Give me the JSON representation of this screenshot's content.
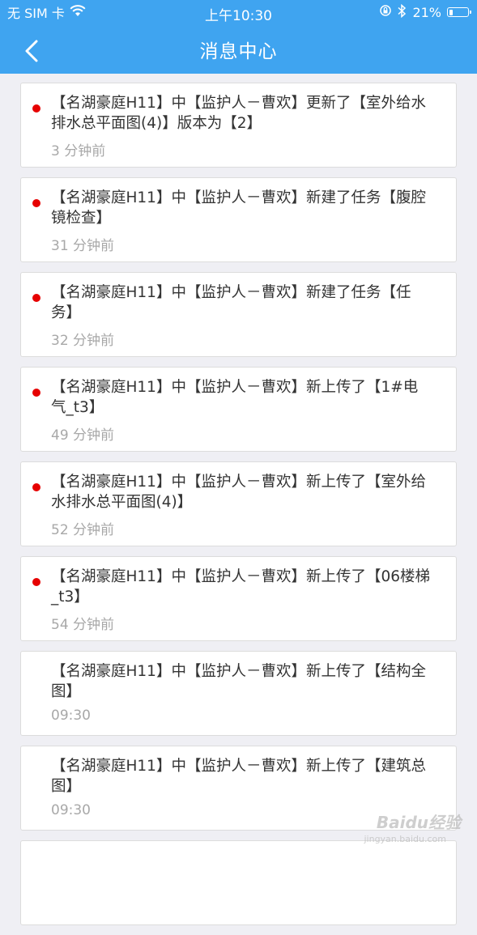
{
  "status_bar": {
    "carrier": "无 SIM 卡",
    "time": "上午10:30",
    "battery_text": "21%",
    "battery_level": 0.21
  },
  "header": {
    "title": "消息中心"
  },
  "messages": [
    {
      "text": "【名湖豪庭H11】中【监护人－曹欢】更新了【室外给水排水总平面图(4)】版本为【2】",
      "time": "3 分钟前",
      "unread": true
    },
    {
      "text": "【名湖豪庭H11】中【监护人－曹欢】新建了任务【腹腔镜检查】",
      "time": "31 分钟前",
      "unread": true
    },
    {
      "text": "【名湖豪庭H11】中【监护人－曹欢】新建了任务【任务】",
      "time": "32 分钟前",
      "unread": true
    },
    {
      "text": "【名湖豪庭H11】中【监护人－曹欢】新上传了【1#电气_t3】",
      "time": "49 分钟前",
      "unread": true
    },
    {
      "text": "【名湖豪庭H11】中【监护人－曹欢】新上传了【室外给水排水总平面图(4)】",
      "time": "52 分钟前",
      "unread": true
    },
    {
      "text": "【名湖豪庭H11】中【监护人－曹欢】新上传了【06楼梯_t3】",
      "time": "54 分钟前",
      "unread": true
    },
    {
      "text": "【名湖豪庭H11】中【监护人－曹欢】新上传了【结构全图】",
      "time": "09:30",
      "unread": false
    },
    {
      "text": "【名湖豪庭H11】中【监护人－曹欢】新上传了【建筑总图】",
      "time": "09:30",
      "unread": false
    },
    {
      "text": "",
      "time": "",
      "unread": false
    }
  ],
  "watermark": {
    "text": "Baidu经验",
    "sub": "jingyan.baidu.com"
  },
  "colors": {
    "header_bg": "#3fa4f0",
    "unread_dot": "#e60000",
    "page_bg": "#efeff4"
  }
}
